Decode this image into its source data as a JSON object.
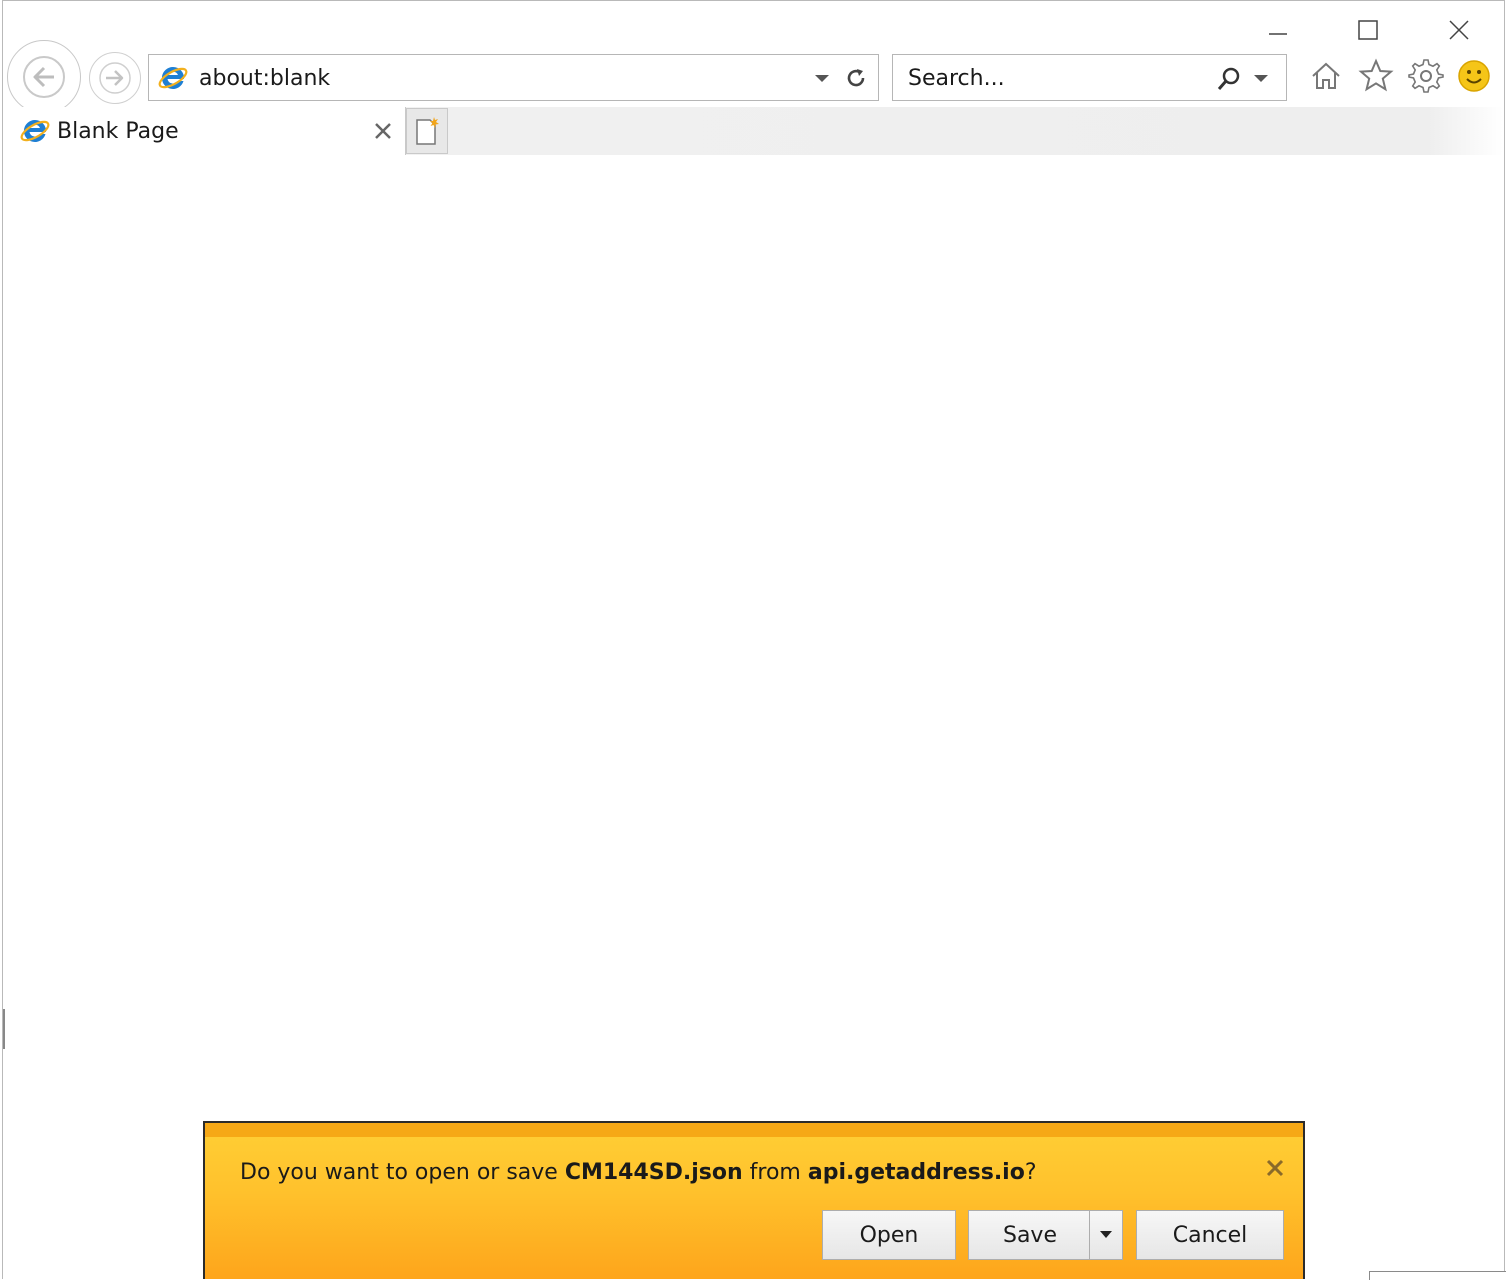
{
  "window": {
    "controls": [
      "minimize-icon",
      "maximize-icon",
      "close-icon"
    ]
  },
  "toolbar": {
    "back_icon": "back-arrow-icon",
    "forward_icon": "forward-arrow-icon",
    "address_value": "about:blank",
    "search_placeholder": "Search...",
    "right_icons": [
      "home-icon",
      "favorites-star-icon",
      "settings-gear-icon",
      "feedback-smiley-icon"
    ]
  },
  "tabs": [
    {
      "title": "Blank Page",
      "active": true
    }
  ],
  "notification": {
    "msg_prefix": "Do you want to open or save ",
    "file_name": "CM144SD.json",
    "msg_middle": " from ",
    "source": "api.getaddress.io",
    "msg_suffix": "?",
    "open_label": "Open",
    "save_label": "Save",
    "cancel_label": "Cancel"
  },
  "colors": {
    "notification_bar": "#ffc12c",
    "notification_top": "#f6a816",
    "ie_blue": "#1e7fd4",
    "ie_gold": "#f2b01e"
  }
}
